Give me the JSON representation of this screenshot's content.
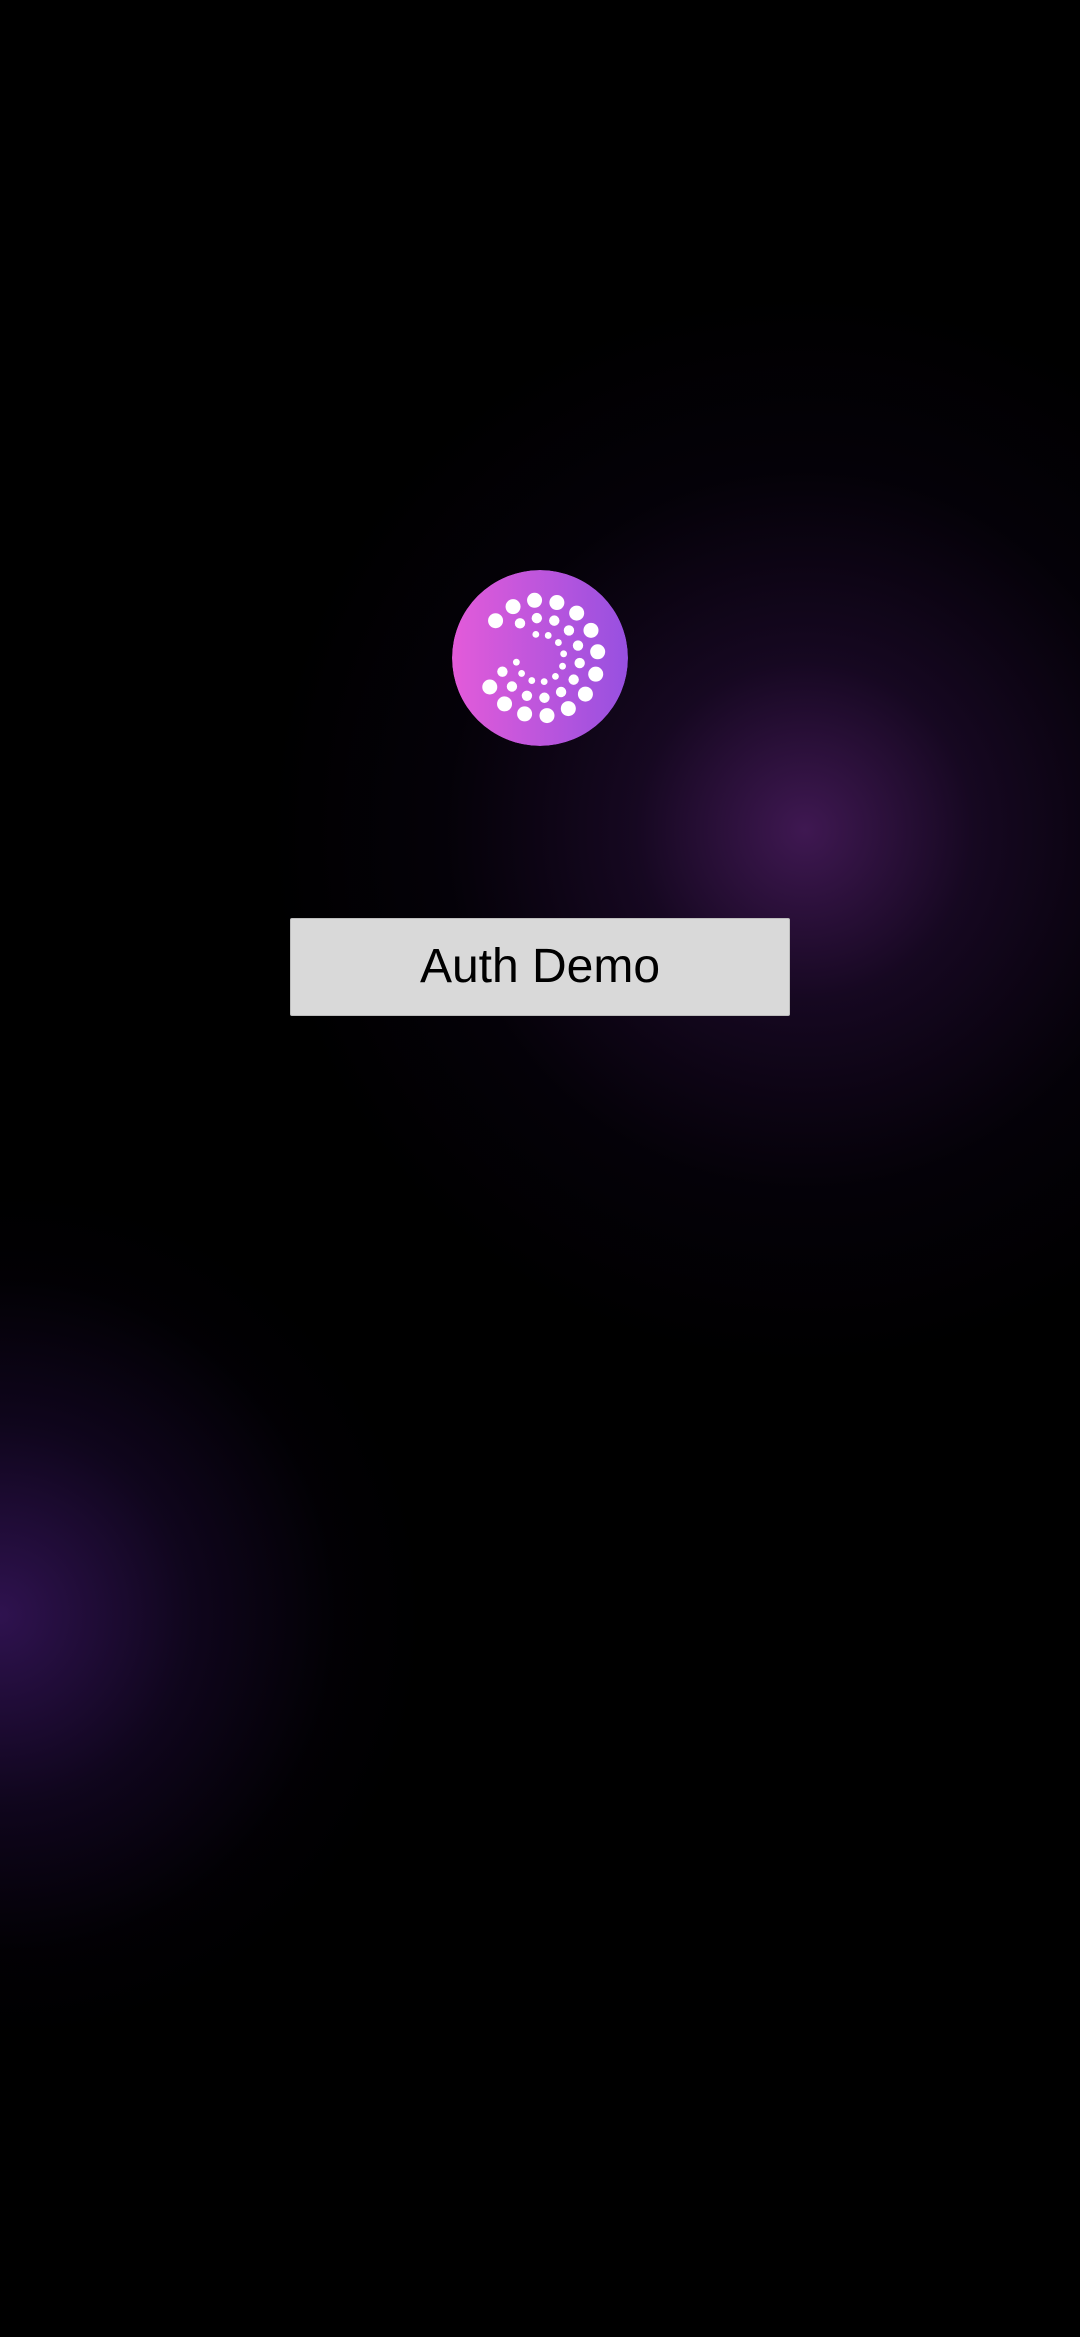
{
  "app": {
    "logo_icon": "dotted-spiral-logo-icon",
    "logo_gradient": [
      "#e05ad8",
      "#9a4ee0"
    ],
    "background": "#000000",
    "glow_color": "#3a1450"
  },
  "main": {
    "button_label": "Auth Demo",
    "button_color": "#d9d9d9"
  }
}
